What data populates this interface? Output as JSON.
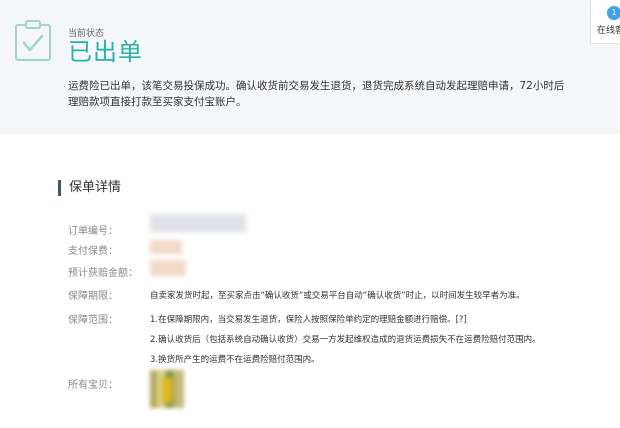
{
  "status": {
    "label": "当前状态",
    "title": "已出单",
    "description_line1": "运费险已出单，该笔交易投保成功。确认收货前交易发生退货，退货完成系统自动发起理赔申请，72小时后",
    "description_line2": "理赔款项直接打款至买家支付宝账户。"
  },
  "online_service": {
    "badge": "1",
    "label": "在线客"
  },
  "details": {
    "section_title": "保单详情",
    "order_no_label": "订单编号：",
    "premium_label": "支付保费：",
    "est_payout_label": "预计获赔金额：",
    "period_label": "保障期限：",
    "period_text": "自卖家发货时起，至买家点击“确认收货”或交易平台自动“确认收货”时止，以时间发生较早者为准。",
    "scope_label": "保障范围：",
    "scope_items": [
      "1.在保障期限内，当交易发生退货，保险人按照保险单约定的理赔金额进行赔偿。[?]",
      "2.确认收货后（包括系统自动确认收货）交易一方发起维权造成的退货运费损失不在运费险赔付范围内。",
      "3.换货所产生的运费不在运费险赔付范围内。"
    ],
    "items_label": "所有宝贝："
  },
  "colors": {
    "accent_teal": "#26b2a9",
    "section_bar": "#3d5872",
    "status_bg": "#f4f6f8"
  }
}
